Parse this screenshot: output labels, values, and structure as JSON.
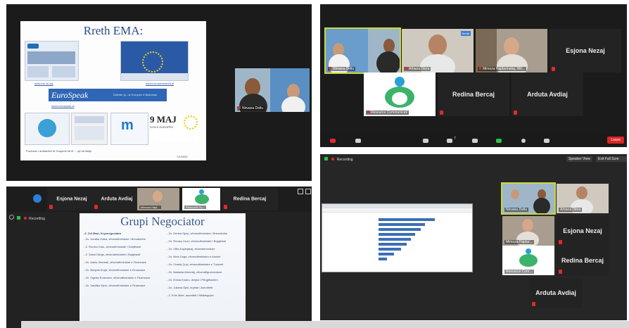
{
  "colors": {
    "panel_bg": "#1b1b1b",
    "tile_bg": "#232323",
    "active_speaker": "#c8d83a",
    "mute": "#e02a2a",
    "leave": "#d92626",
    "chart_bar": "#3b6fb5"
  },
  "top_left": {
    "slide": {
      "title": "Rreth EMA:",
      "link1": "www.em-al.org",
      "link2": "www.euroskonventa.al",
      "link3": "www.eurospeak.al",
      "eurospeak_logo": "EuroSpeak",
      "eurospeak_tagline": "Debate: jo, ne Europen e Bashkuar",
      "date_badge_day": "9 MAJ",
      "date_badge_sub": "DITA E EUROPËS",
      "caption": "Pozicioni i anëtarëve të Grupimit në të ... që ka lidhje",
      "date_small": "7/1/2020"
    },
    "participants": [
      {
        "name": "Nirvana Deliu"
      }
    ]
  },
  "top_right": {
    "participants": [
      {
        "name": "Nirvana Deliu",
        "active": true
      },
      {
        "name": "Arbana Dibra",
        "badge": "Nenjë"
      },
      {
        "name": "Mimoza Hajdarmataj, Wil..."
      },
      {
        "name": "Esjona Nezaj"
      },
      {
        "name": "Resource Communicati"
      },
      {
        "name": "Redina Bercaj"
      },
      {
        "name": "Arduta Avdiaj"
      }
    ],
    "toolbar": {
      "participants_count": "7",
      "leave": "Leave"
    }
  },
  "bottom_left": {
    "top_strip": [
      {
        "name": "Esjona Nezaj"
      },
      {
        "name": "Arduta Avdiaj"
      },
      {
        "name": "Mimoza Hajd..."
      },
      {
        "name": "Resource Co..."
      },
      {
        "name": "Redina Bercaj"
      }
    ],
    "recording": "Recording",
    "slide": {
      "title": "Grupi Negociator",
      "col1": [
        "-Z. Zef Mazi, Kryenegociator",
        "- Zn. Ilonaka Gaba, zëvendëministre i Brendshëm",
        "- Z. Romeo Kolo, zëvendëministër i Drejtësisë",
        "- Z. Sokol Dedja, zëvendëministër i Bujqësisë",
        "- Zn. Adela Xhemali, zëvendëministre e Financave",
        "- Zn. Bonjola Kruja, zëvendëministre e Financave",
        "- Zn. Ogerta Sorensen, zëvendëministre e Financave",
        "- Zn. Vasilika Vjero, zëvendëministre e Financave"
      ],
      "col2": [
        "- Zn. Ermira Gjeçi, zëvendëministre i Brendshëm",
        "- Zn. Romeo Kezo, zëvendëministër i Bujqësisë",
        "- Zn. Olita Kapinjakaj, zëvendëministre",
        "- Zn. Nina Guga, zëvendëministre e Arsimit",
        "- Zn. Ornela Çuçi, zëvendëministre e Turizmit",
        "- Zn. Natasha Ahmetaj, zëvendëguvernatore",
        "- Zn. Evisia Kostro, drejtor i Përgjithshëm",
        "- Zn. Juliana Gjini, kryetar i Autoritetit",
        "- Z. Evin Mele, autoriteti i Mbikëqyrjes"
      ]
    }
  },
  "bottom_right": {
    "recording": "Recording",
    "speaker_view": "Speaker View",
    "exit_full": "Exit Full Scre",
    "participants": [
      {
        "name": "Nirvana Deliu",
        "active": true
      },
      {
        "name": "Arbana Dibra"
      },
      {
        "name": "Mimoza Hajdar..."
      },
      {
        "name": "Esjona Nezaj"
      },
      {
        "name": "Resource Com..."
      },
      {
        "name": "Redina Bercaj"
      },
      {
        "name": "Arduta Avdiaj"
      }
    ]
  }
}
